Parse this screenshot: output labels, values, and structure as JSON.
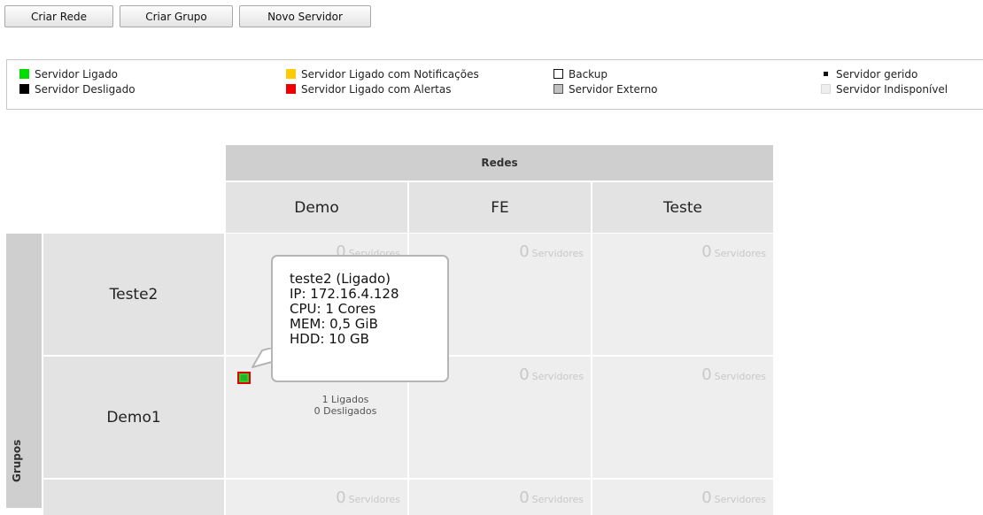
{
  "toolbar": {
    "buttons": [
      {
        "label": "Criar Rede"
      },
      {
        "label": "Criar Grupo"
      },
      {
        "label": "Novo Servidor"
      }
    ]
  },
  "legend": {
    "items": [
      {
        "label": "Servidor Ligado",
        "color": "#00dd00"
      },
      {
        "label": "Servidor Desligado",
        "color": "#000000"
      },
      {
        "label": "Servidor Ligado com Notificações",
        "color": "#ffcc00"
      },
      {
        "label": "Servidor Ligado com Alertas",
        "color": "#ee0000"
      },
      {
        "label": "Backup",
        "color": "#ffffff"
      },
      {
        "label": "Servidor Externo",
        "color": "#c0c0c0"
      },
      {
        "label": "Servidor gerido",
        "color": "#000000"
      },
      {
        "label": "Servidor Indisponível",
        "color": "#eeeeee"
      }
    ]
  },
  "matrix": {
    "redes_label": "Redes",
    "grupos_label": "Grupos",
    "columns": [
      "Demo",
      "FE",
      "Teste"
    ],
    "rows": [
      {
        "name": "Teste2",
        "cells": [
          {
            "count": "0",
            "unit": "Servidores"
          },
          {
            "count": "0",
            "unit": "Servidores"
          },
          {
            "count": "0",
            "unit": "Servidores"
          }
        ]
      },
      {
        "name": "Demo1",
        "cells": [
          {
            "stats": [
              "1 Ligados",
              "0 Desligados"
            ]
          },
          {
            "count": "0",
            "unit": "Servidores"
          },
          {
            "count": "0",
            "unit": "Servidores"
          }
        ]
      },
      {
        "name": "",
        "cells": [
          {
            "count": "0",
            "unit": "Servidores"
          },
          {
            "count": "0",
            "unit": "Servidores"
          },
          {
            "count": "0",
            "unit": "Servidores"
          }
        ]
      }
    ]
  },
  "tooltip": {
    "lines": [
      "teste2 (Ligado)",
      "IP: 172.16.4.128",
      "CPU: 1 Cores",
      "MEM: 0,5 GiB",
      "HDD: 10 GB"
    ]
  },
  "server": {
    "status": "Ligado com Alertas",
    "fill_color": "#2ecc2e",
    "border_color": "#e00000"
  }
}
